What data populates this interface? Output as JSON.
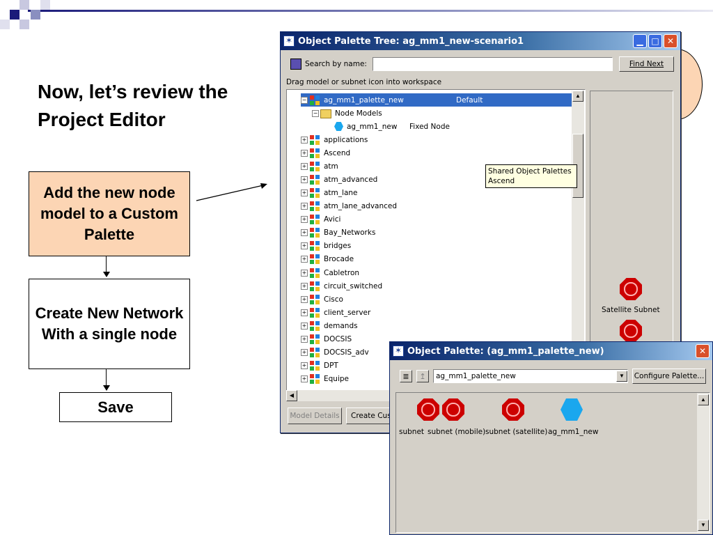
{
  "slide": {
    "title": "Now, let’s review the Project Editor",
    "flow_box1": "Add the new node model to a Custom Palette",
    "flow_box2": "Create New Network With a single node",
    "flow_box3": "Save"
  },
  "colors": {
    "accent_box": "#fcd5b4",
    "title_bar": "#0a246a",
    "selection": "#316ac5",
    "tooltip": "#ffffe1"
  },
  "tree_window": {
    "title": "Object Palette Tree: ag_mm1_new-scenario1",
    "title_icon": "opnet-star-icon",
    "search_label": "Search by name:",
    "search_value": "",
    "find_next": "Find Next",
    "instruction": "Drag model or subnet icon into workspace",
    "selected_item": {
      "name": "ag_mm1_palette_new",
      "value": "Default"
    },
    "folder_label": "Node Models",
    "model_item": {
      "name": "ag_mm1_new",
      "type": "Fixed Node"
    },
    "items": [
      "applications",
      "Ascend",
      "atm",
      "atm_advanced",
      "atm_lane",
      "atm_lane_advanced",
      "Avici",
      "Bay_Networks",
      "bridges",
      "Brocade",
      "Cabletron",
      "circuit_switched",
      "Cisco",
      "client_server",
      "demands",
      "DOCSIS",
      "DOCSIS_adv",
      "DPT",
      "Equipe"
    ],
    "tooltip_line1": "Shared Object Palettes",
    "tooltip_line2": "Ascend",
    "preview_label": "Satellite Subnet",
    "btn_model_details": "Model Details",
    "btn_create_custom": "Create Cust"
  },
  "palette_window": {
    "title": "Object Palette: (ag_mm1_palette_new)",
    "palette_select": "ag_mm1_palette_new",
    "configure": "Configure Palette...",
    "icons": [
      {
        "label": "subnet",
        "icon": "subnet-icon"
      },
      {
        "label": "subnet (mobile)",
        "icon": "subnet-mobile-icon"
      },
      {
        "label": "subnet (satellite)",
        "icon": "subnet-satellite-icon"
      },
      {
        "label": "ag_mm1_new",
        "icon": "node-model-icon"
      }
    ]
  }
}
